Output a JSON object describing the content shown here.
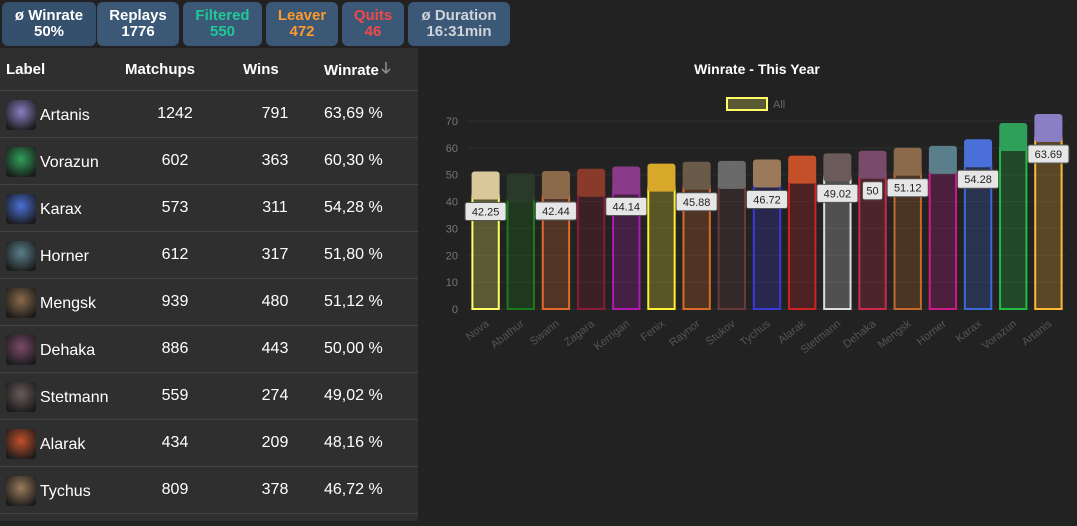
{
  "stats": {
    "winrate": {
      "title": "ø Winrate",
      "value": "50%"
    },
    "replays": {
      "title": "Replays",
      "value": "1776"
    },
    "filtered": {
      "title": "Filtered",
      "value": "550"
    },
    "leaver": {
      "title": "Leaver",
      "value": "472"
    },
    "quits": {
      "title": "Quits",
      "value": "46"
    },
    "duration": {
      "title": "ø Duration",
      "value": "16:31min"
    }
  },
  "table": {
    "headers": {
      "label": "Label",
      "matchups": "Matchups",
      "wins": "Wins",
      "winrate": "Winrate"
    },
    "sort_icon": "arrow-down-icon",
    "rows": [
      {
        "label": "Artanis",
        "matchups": "1242",
        "wins": "791",
        "winrate": "63,69 %",
        "color": "#8a7fc4"
      },
      {
        "label": "Vorazun",
        "matchups": "602",
        "wins": "363",
        "winrate": "60,30 %",
        "color": "#2fa05a"
      },
      {
        "label": "Karax",
        "matchups": "573",
        "wins": "311",
        "winrate": "54,28 %",
        "color": "#4a6fd8"
      },
      {
        "label": "Horner",
        "matchups": "612",
        "wins": "317",
        "winrate": "51,80 %",
        "color": "#5a7f8a"
      },
      {
        "label": "Mengsk",
        "matchups": "939",
        "wins": "480",
        "winrate": "51,12 %",
        "color": "#8a6a4a"
      },
      {
        "label": "Dehaka",
        "matchups": "886",
        "wins": "443",
        "winrate": "50,00 %",
        "color": "#7a4a6a"
      },
      {
        "label": "Stetmann",
        "matchups": "559",
        "wins": "274",
        "winrate": "49,02 %",
        "color": "#6a5a5a"
      },
      {
        "label": "Alarak",
        "matchups": "434",
        "wins": "209",
        "winrate": "48,16 %",
        "color": "#c4502a"
      },
      {
        "label": "Tychus",
        "matchups": "809",
        "wins": "378",
        "winrate": "46,72 %",
        "color": "#9a7a5a"
      }
    ]
  },
  "chart_data": {
    "type": "bar",
    "title": "Winrate - This Year",
    "legend": {
      "label": "All",
      "position": "top"
    },
    "ylim": [
      0,
      70
    ],
    "yticks": [
      0,
      10,
      20,
      30,
      40,
      50,
      60,
      70
    ],
    "grid": true,
    "categories": [
      "Nova",
      "Abathur",
      "Swann",
      "Zagara",
      "Kerrigan",
      "Fenix",
      "Raynor",
      "Stukov",
      "Tychus",
      "Alarak",
      "Stetmann",
      "Dehaka",
      "Mengsk",
      "Horner",
      "Karax",
      "Vorazun",
      "Artanis"
    ],
    "values": [
      42.25,
      41.5,
      42.44,
      43.3,
      44.14,
      45.2,
      45.88,
      46.2,
      46.72,
      48.16,
      49.02,
      50,
      51.12,
      51.8,
      54.28,
      60.3,
      63.69
    ],
    "data_labels": [
      "42.25",
      "",
      "42.44",
      "",
      "44.14",
      "",
      "45.88",
      "",
      "46.72",
      "",
      "49.02",
      "50",
      "51.12",
      "",
      "54.28",
      "",
      "63.69"
    ],
    "bar_colors": [
      "#ffff66",
      "#1a7a1a",
      "#e06a2a",
      "#8a1a3a",
      "#b01ab0",
      "#ffee33",
      "#d86a2a",
      "#6a3a3a",
      "#3a3ad8",
      "#cc2222",
      "#dddddd",
      "#cc2a4a",
      "#c46a2a",
      "#cc1a8a",
      "#3a6ad8",
      "#22bb44",
      "#ffb833"
    ],
    "portrait_colors": [
      "#d9c99a",
      "#2a3a2a",
      "#8a6a4a",
      "#8a3a2a",
      "#8a3a8a",
      "#d8a82a",
      "#6a5a4a",
      "#6a6a6a",
      "#9a7a5a",
      "#c4502a",
      "#6a5a5a",
      "#7a4a6a",
      "#8a6a4a",
      "#5a7f8a",
      "#4a6fd8",
      "#2fa05a",
      "#8a7fc4"
    ]
  }
}
